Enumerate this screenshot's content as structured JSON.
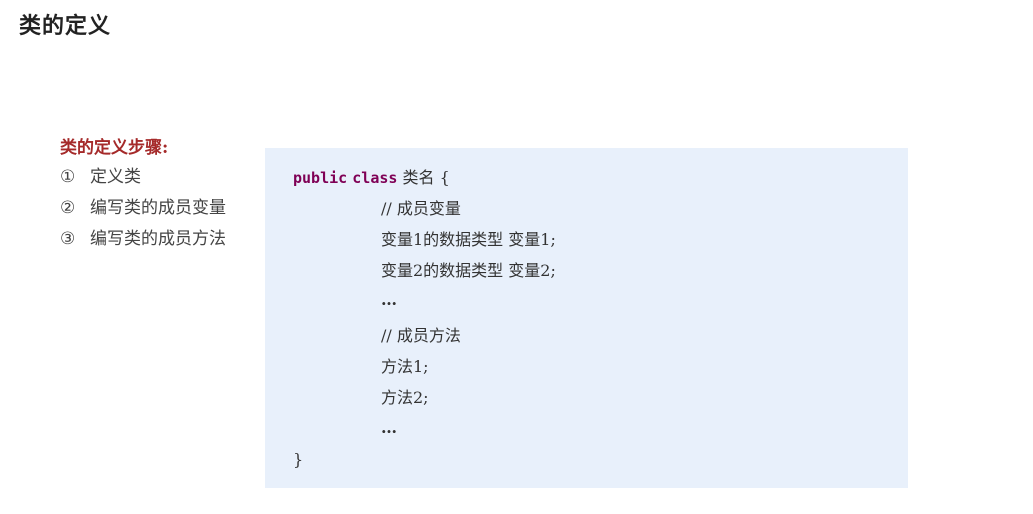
{
  "page": {
    "title": "类的定义"
  },
  "steps": {
    "heading": "类的定义步骤:",
    "items": [
      {
        "num": "①",
        "label": "定义类"
      },
      {
        "num": "②",
        "label": "编写类的成员变量"
      },
      {
        "num": "③",
        "label": "编写类的成员方法"
      }
    ]
  },
  "code": {
    "kw_public": "public",
    "kw_class": "class",
    "class_name": " 类名 {",
    "comment_vars": "// 成员变量",
    "var1": "变量1的数据类型 变量1;",
    "var2": "变量2的数据类型 变量2;",
    "ellipsis1": "…",
    "comment_methods": "// 成员方法",
    "method1": "方法1;",
    "method2": "方法2;",
    "ellipsis2": "…",
    "close_brace": "}"
  }
}
